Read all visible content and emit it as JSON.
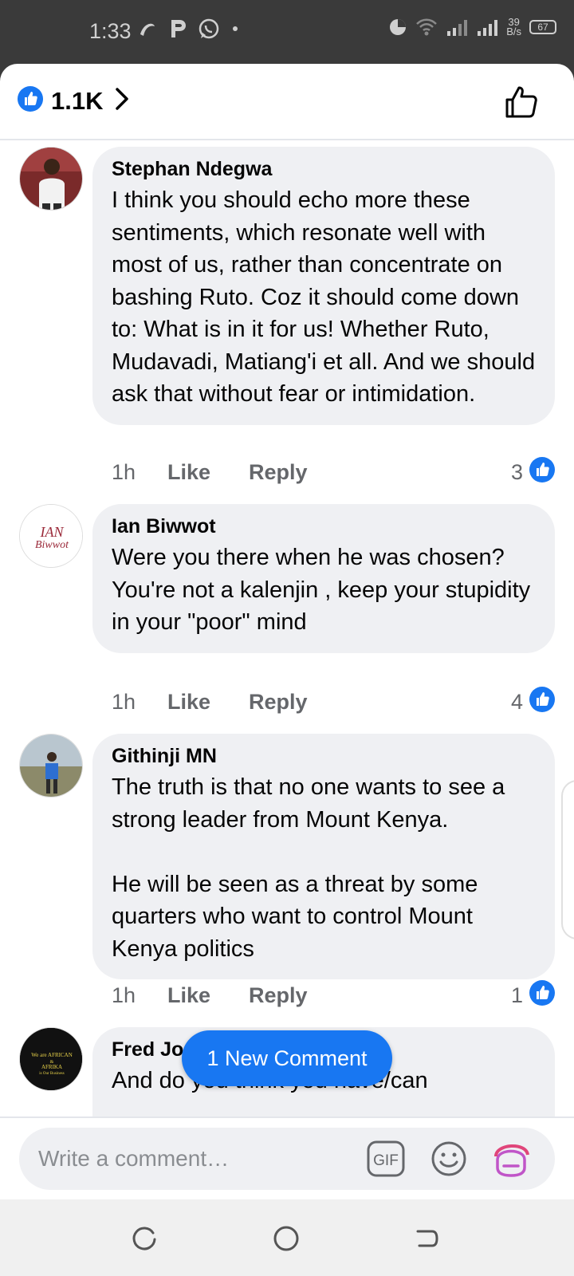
{
  "status_bar": {
    "time": "1:33",
    "net_speed_value": "39",
    "net_speed_unit": "B/s",
    "battery": "67"
  },
  "header": {
    "like_count": "1.1K"
  },
  "comments": [
    {
      "author": "Stephan Ndegwa",
      "text": "I think you should echo more these sentiments, which resonate well with most of us, rather than concentrate on bashing Ruto. Coz it should come down to: What is in it for us! Whether Ruto, Mudavadi, Matiang'i et all. And we should ask that without fear or intimidation.",
      "time": "1h",
      "like_label": "Like",
      "reply_label": "Reply",
      "reactions": "3"
    },
    {
      "author": "Ian Biwwot",
      "text": "Were you there when he was chosen?\nYou're not a kalenjin , keep your stupidity in your \"poor\" mind",
      "time": "1h",
      "like_label": "Like",
      "reply_label": "Reply",
      "reactions": "4",
      "avatar_text": "IAN Biwwot"
    },
    {
      "author": "Githinji MN",
      "text": "The truth is that no one wants to see a strong leader from Mount Kenya.\n\nHe will be seen as a threat by some quarters who want to control Mount Kenya politics",
      "time": "1h",
      "like_label": "Like",
      "reply_label": "Reply",
      "reactions": "1"
    },
    {
      "author": "Fred Jo",
      "text": "And do you think you have/can",
      "avatar_text": "We are AFRICAN & AFRIKA is Our Business"
    }
  ],
  "new_comment_pill": "1 New Comment",
  "composer": {
    "placeholder": "Write a comment…",
    "gif_label": "GIF"
  },
  "colors": {
    "brand_blue": "#1877f2",
    "bubble_bg": "#eff0f3",
    "meta_gray": "#65676b",
    "avatar_sticker": "#c055c8"
  },
  "icons": [
    "like-badge-icon",
    "chevron-right-icon",
    "thumbs-up-outline-icon",
    "gif-icon",
    "emoji-icon",
    "avatar-sticker-icon",
    "recents-icon",
    "home-icon",
    "back-icon"
  ]
}
